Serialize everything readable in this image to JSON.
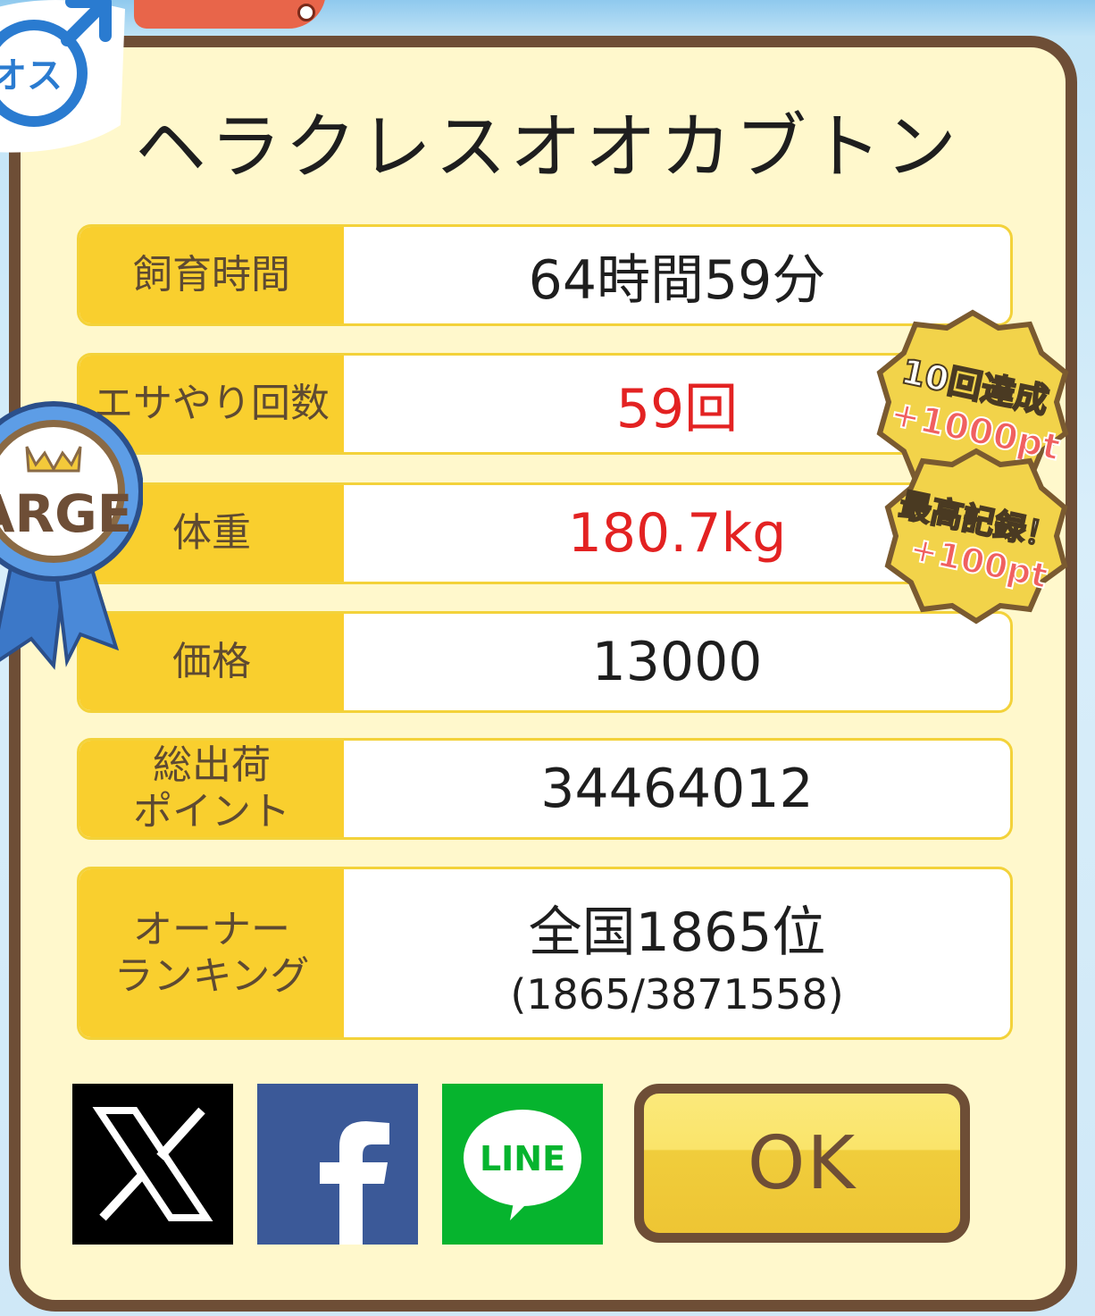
{
  "title": "ヘラクレスオオカブトン",
  "gender_badge": "オス",
  "size_ribbon": "ARGE",
  "stats": [
    {
      "label": "飼育時間",
      "value": "64時間59分"
    },
    {
      "label": "エサやり回数",
      "value": "59回"
    },
    {
      "label": "体重",
      "value": "180.7kg"
    },
    {
      "label": "価格",
      "value": "13000"
    },
    {
      "label_lines": [
        "総出荷",
        "ポイント"
      ],
      "value": "34464012"
    },
    {
      "label_lines": [
        "オーナー",
        "ランキング"
      ],
      "value": "全国1865位",
      "sub_value": "(1865/3871558)"
    }
  ],
  "achievements": [
    {
      "line1": "10回達成",
      "line2": "+1000pt"
    },
    {
      "line1": "最高記録！",
      "line2": "+100pt"
    }
  ],
  "share": {
    "x_icon": "x-logo-icon",
    "facebook_icon": "facebook-logo-icon",
    "line_label": "LINE"
  },
  "ok_label": "OK",
  "colors": {
    "panel_border": "#6e4e36",
    "panel_bg": "#fff8cc",
    "label_bg": "#f9cf2e",
    "highlight_red": "#e32222",
    "facebook": "#3b5998",
    "line": "#06b42e"
  }
}
